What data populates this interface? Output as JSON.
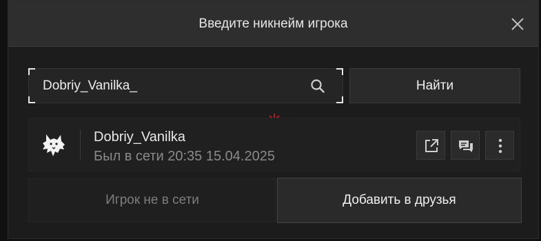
{
  "dialog": {
    "title": "Введите никнейм игрока",
    "close_icon": "close-icon"
  },
  "search": {
    "value": "Dobriy_Vanilka_",
    "icon": "search-icon",
    "button_label": "Найти"
  },
  "player": {
    "name": "Dobriy_Vanilka",
    "status": "Был в сети 20:35 15.04.2025",
    "avatar_icon": "wolf-avatar-icon",
    "actions": [
      {
        "icon": "open-external-icon"
      },
      {
        "icon": "chat-icon"
      },
      {
        "icon": "more-vertical-icon"
      }
    ]
  },
  "footer": {
    "offline_label": "Игрок не в сети",
    "add_friend_label": "Добавить в друзья"
  },
  "colors": {
    "crosshair": "#d21f1f",
    "background": "#1c1c1c",
    "header": "#2e2e2e"
  }
}
